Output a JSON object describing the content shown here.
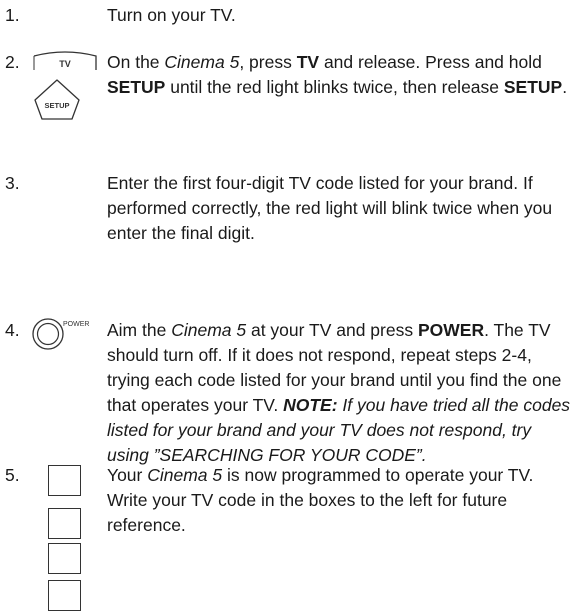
{
  "steps": [
    {
      "number": "1.",
      "text": "Turn on your TV."
    },
    {
      "number": "2.",
      "icons": {
        "tv_key": "TV",
        "setup_key": "SETUP"
      },
      "segments": [
        "On the ",
        "Cinema 5",
        ", press ",
        "TV",
        " and release. Press and hold ",
        "SETUP",
        " until the red light blinks twice, then release ",
        "SETUP",
        "."
      ]
    },
    {
      "number": "3.",
      "text": "Enter the first four-digit TV code listed for your brand. If performed correctly, the red light will blink twice when you enter the final digit."
    },
    {
      "number": "4.",
      "icons": {
        "power_key": "POWER"
      },
      "segments": [
        "Aim the ",
        "Cinema 5",
        " at your TV and press ",
        "POWER",
        ". The TV should turn off. If it does not respond, repeat steps 2-4, trying each code listed for your brand until you find the one that operates your TV. "
      ],
      "note_label": "NOTE:",
      "note_text": " If you have tried all the codes listed for your brand and your TV does not respond, try using ”SEARCHING FOR YOUR CODE”."
    },
    {
      "number": "5.",
      "segments": [
        "Your ",
        "Cinema 5",
        " is now programmed to operate your TV. Write your TV code in the boxes to the left for future reference."
      ],
      "code_boxes": [
        "",
        "",
        "",
        ""
      ]
    }
  ]
}
